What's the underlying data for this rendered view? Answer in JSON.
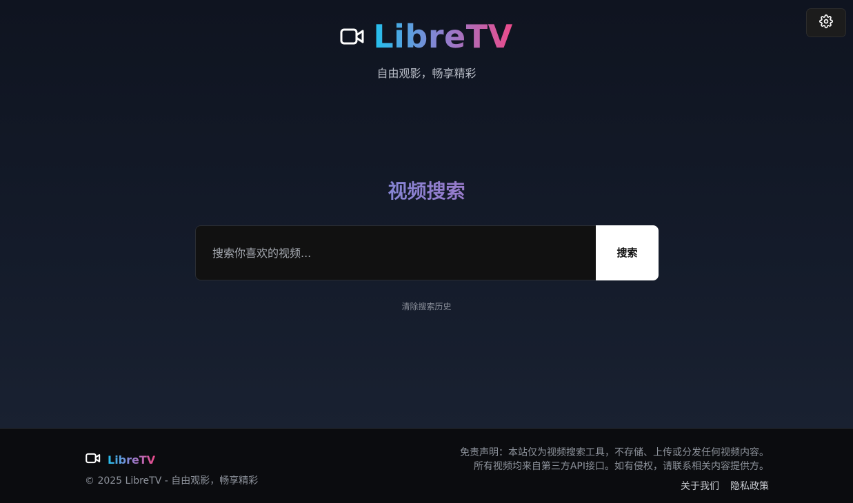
{
  "header": {
    "brand": "LibreTV",
    "tagline": "自由观影，畅享精彩",
    "logo_icon": "video-camera-icon",
    "settings_icon": "gear-icon"
  },
  "search": {
    "heading": "视频搜索",
    "placeholder": "搜索你喜欢的视频...",
    "button_label": "搜索",
    "clear_history": "清除搜索历史"
  },
  "footer": {
    "brand": "LibreTV",
    "copyright": "© 2025 LibreTV - 自由观影，畅享精彩",
    "disclaimer_line1": "免责声明：本站仅为视频搜索工具，不存储、上传或分发任何视频内容。",
    "disclaimer_line2": "所有视频均来自第三方API接口。如有侵权，请联系相关内容提供方。",
    "links": [
      "关于我们",
      "隐私政策"
    ]
  },
  "colors": {
    "gradient_start": "#22c1ee",
    "gradient_mid": "#8f7fd0",
    "gradient_end": "#ec4a8a",
    "search_button_bg": "#ffffff"
  }
}
